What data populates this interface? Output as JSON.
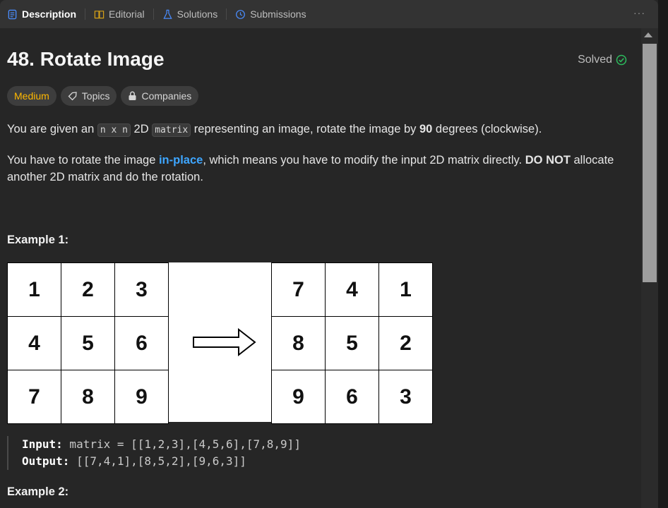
{
  "tabs": [
    {
      "label": "Description",
      "icon": "description-icon",
      "active": true
    },
    {
      "label": "Editorial",
      "icon": "book-icon"
    },
    {
      "label": "Solutions",
      "icon": "flask-icon"
    },
    {
      "label": "Submissions",
      "icon": "history-icon"
    }
  ],
  "more_label": "···",
  "problem": {
    "title": "48. Rotate Image",
    "status": "Solved",
    "tags": {
      "difficulty": "Medium",
      "topics": "Topics",
      "companies": "Companies"
    }
  },
  "description": {
    "p1": {
      "t1": "You are given an ",
      "c1": "n x n",
      "t2": " 2D ",
      "c2": "matrix",
      "t3": " representing an image, rotate the image by ",
      "b1": "90",
      "t4": " degrees (clockwise)."
    },
    "p2": {
      "t1": "You have to rotate the image ",
      "link": "in-place",
      "t2": ", which means you have to modify the input 2D matrix directly. ",
      "b1": "DO NOT",
      "t3": " allocate another 2D matrix and do the rotation."
    }
  },
  "example1": {
    "heading": "Example 1:",
    "input_grid": [
      "1",
      "2",
      "3",
      "4",
      "5",
      "6",
      "7",
      "8",
      "9"
    ],
    "output_grid": [
      "7",
      "4",
      "1",
      "8",
      "5",
      "2",
      "9",
      "6",
      "3"
    ],
    "input_label": "Input:",
    "input_value": " matrix = [[1,2,3],[4,5,6],[7,8,9]]",
    "output_label": "Output:",
    "output_value": " [[7,4,1],[8,5,2],[9,6,3]]"
  },
  "example2": {
    "heading": "Example 2:"
  },
  "colors": {
    "accent_blue": "#3ea6ff",
    "medium": "#ffb800",
    "solved_check": "#2cbb5d"
  }
}
